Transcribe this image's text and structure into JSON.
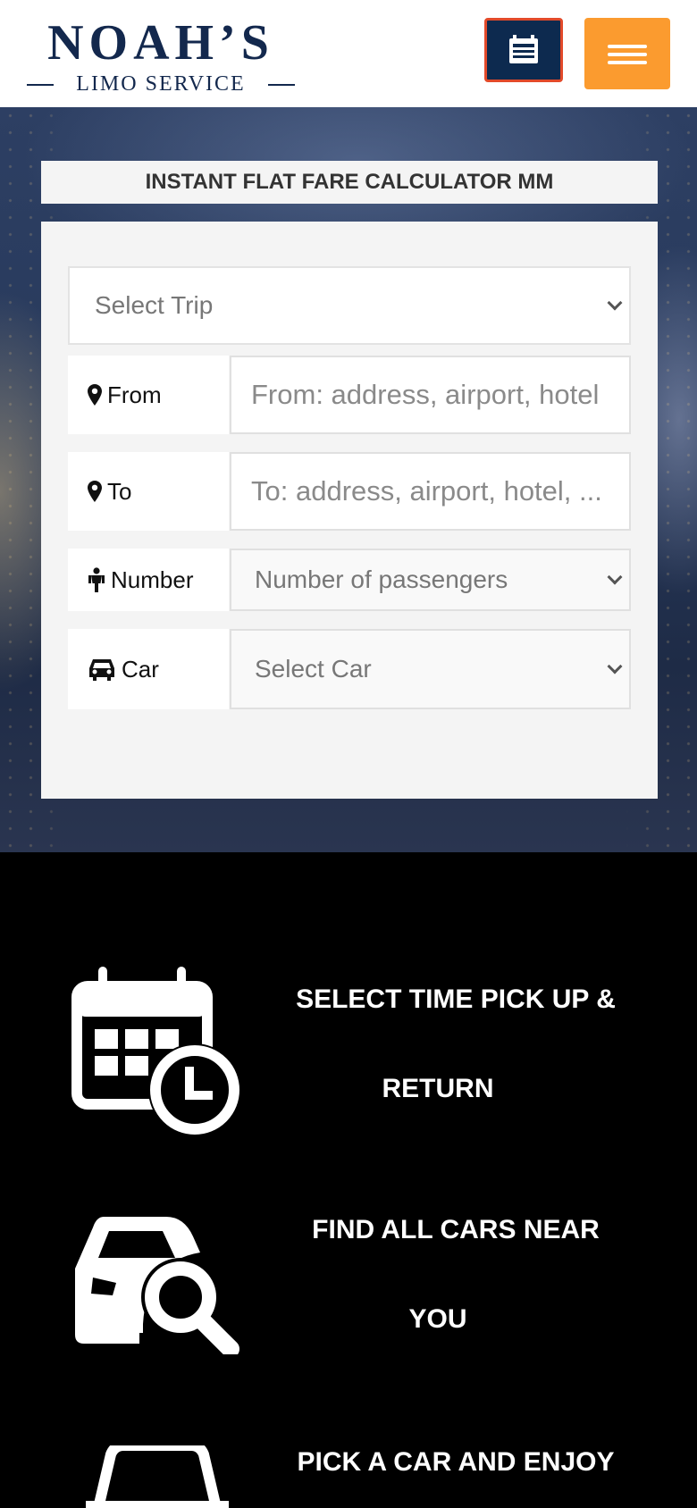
{
  "header": {
    "logo_main": "NOAH’S",
    "logo_sub": "LIMO SERVICE",
    "book_icon": "reservation-icon",
    "menu_icon": "hamburger-icon"
  },
  "calculator": {
    "title": "INSTANT FLAT FARE CALCULATOR MM",
    "trip_select": "Select Trip",
    "from_label": "From",
    "from_placeholder": "From: address, airport, hotel",
    "to_label": "To",
    "to_placeholder": "To: address, airport, hotel, ...",
    "number_label": "Number",
    "number_select": "Number of passengers",
    "car_label": "Car",
    "car_select": "Select Car"
  },
  "features": [
    {
      "line1": "SELECT TIME PICK UP &",
      "line2": "RETURN",
      "icon": "calendar-clock-icon"
    },
    {
      "line1": "FIND ALL CARS NEAR",
      "line2": "YOU",
      "icon": "car-search-icon"
    },
    {
      "line1": "PICK A CAR AND ENJOY",
      "line2": "",
      "icon": "car-icon"
    }
  ],
  "colors": {
    "brand_navy": "#13284d",
    "book_button": "#0d2a4f",
    "book_border": "#e24a2a",
    "menu_button": "#fb9b2f"
  }
}
